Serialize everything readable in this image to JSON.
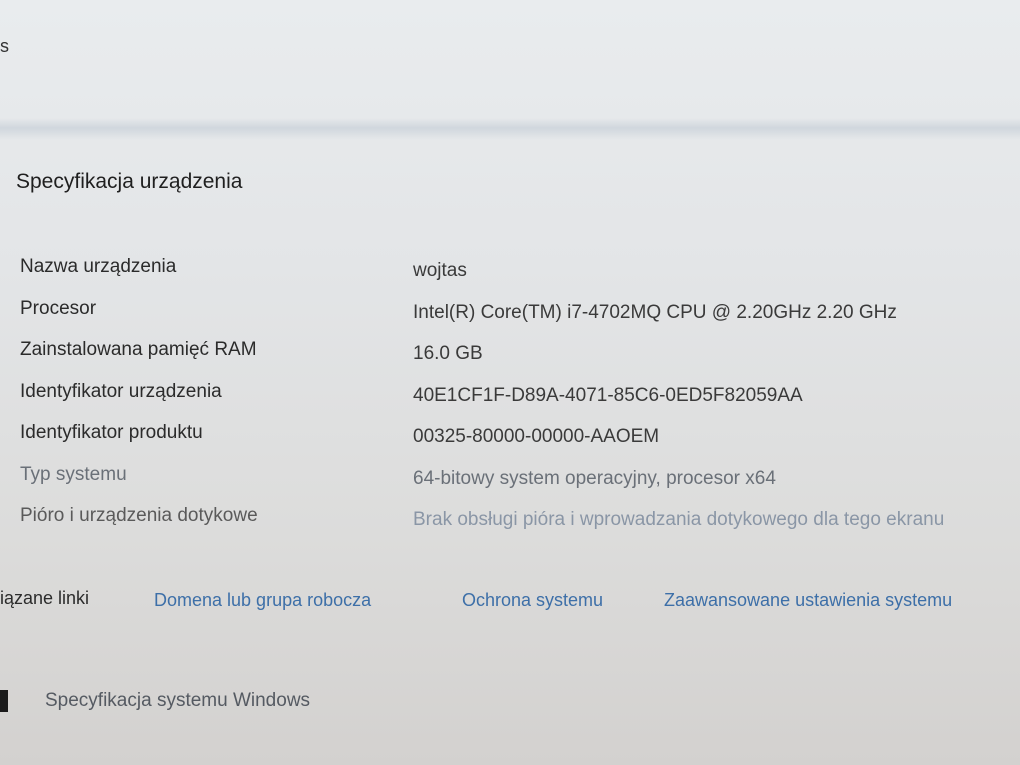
{
  "header": {
    "cut_text": "s"
  },
  "section": {
    "title": "Specyfikacja urządzenia"
  },
  "specs": [
    {
      "label": "Nazwa urządzenia",
      "value": "wojtas"
    },
    {
      "label": "Procesor",
      "value": "Intel(R) Core(TM) i7-4702MQ CPU @ 2.20GHz   2.20 GHz"
    },
    {
      "label": "Zainstalowana pamięć RAM",
      "value": "16.0 GB"
    },
    {
      "label": "Identyfikator urządzenia",
      "value": "40E1CF1F-D89A-4071-85C6-0ED5F82059AA"
    },
    {
      "label": "Identyfikator produktu",
      "value": "00325-80000-00000-AAOEM"
    },
    {
      "label": "Typ systemu",
      "value": "64-bitowy system operacyjny, procesor x64"
    },
    {
      "label": "Pióro i urządzenia dotykowe",
      "value": "Brak obsługi pióra i wprowadzania dotykowego dla tego ekranu"
    }
  ],
  "related_links": {
    "label": "iązane linki",
    "items": [
      {
        "label": "Domena lub grupa robocza"
      },
      {
        "label": "Ochrona systemu"
      },
      {
        "label": "Zaawansowane ustawienia systemu"
      }
    ]
  },
  "windows_spec": {
    "label": "Specyfikacja systemu Windows"
  }
}
